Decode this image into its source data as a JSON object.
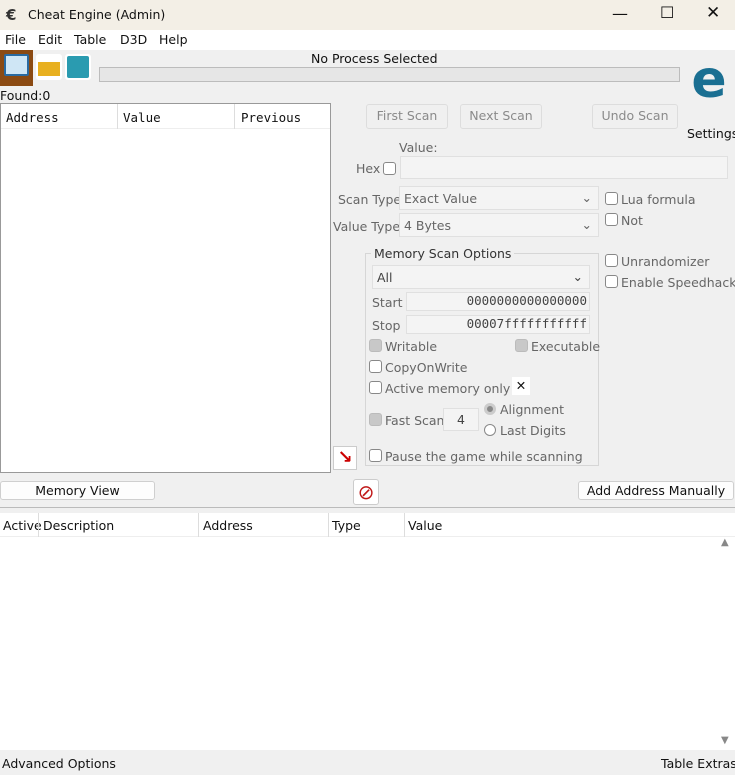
{
  "window": {
    "title": "Cheat Engine (Admin)"
  },
  "menu": [
    "File",
    "Edit",
    "Table",
    "D3D",
    "Help"
  ],
  "process": {
    "label": "No Process Selected",
    "found": "Found:0"
  },
  "settings_label": "Settings",
  "results_columns": [
    "Address",
    "Value",
    "Previous"
  ],
  "scan": {
    "first": "First Scan",
    "next": "Next Scan",
    "undo": "Undo Scan",
    "value_label": "Value:",
    "hex": "Hex",
    "scan_type_label": "Scan Type",
    "scan_type": "Exact Value",
    "value_type_label": "Value Type",
    "value_type": "4 Bytes",
    "lua": "Lua formula",
    "not": "Not"
  },
  "memory": {
    "title": "Memory Scan Options",
    "region": "All",
    "start_label": "Start",
    "start": "0000000000000000",
    "stop_label": "Stop",
    "stop": "00007fffffffffff",
    "writable": "Writable",
    "executable": "Executable",
    "cow": "CopyOnWrite",
    "active": "Active memory only",
    "fast": "Fast Scan",
    "fast_value": "4",
    "alignment": "Alignment",
    "last_digits": "Last Digits",
    "pause": "Pause the game while scanning"
  },
  "extra": {
    "unrandomizer": "Unrandomizer",
    "speedhack": "Enable Speedhack"
  },
  "buttons": {
    "memory_view": "Memory View",
    "add_address": "Add Address Manually"
  },
  "table_columns": [
    "Active",
    "Description",
    "Address",
    "Type",
    "Value"
  ],
  "footer": {
    "advanced": "Advanced Options",
    "extras": "Table Extras"
  }
}
